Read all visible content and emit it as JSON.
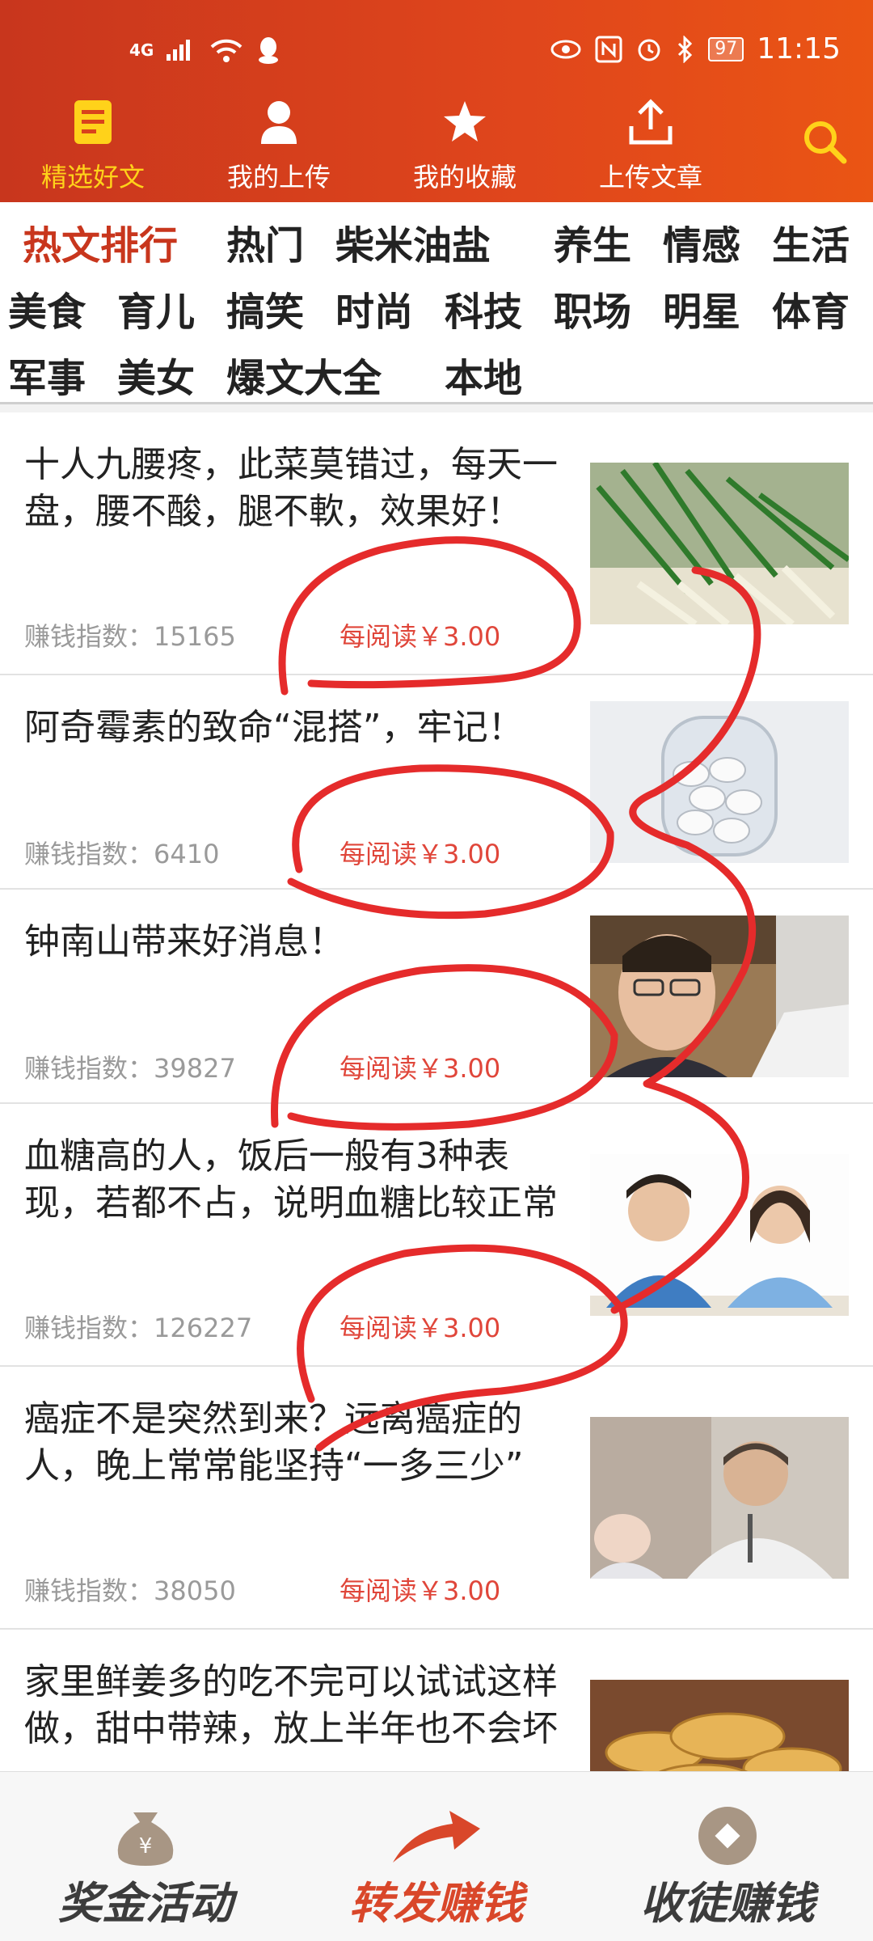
{
  "status": {
    "network": "4G",
    "battery": "97",
    "time": "11:15"
  },
  "topnav": [
    {
      "label": "精选好文",
      "icon": "document-icon"
    },
    {
      "label": "我的上传",
      "icon": "user-icon"
    },
    {
      "label": "我的收藏",
      "icon": "star-icon"
    },
    {
      "label": "上传文章",
      "icon": "upload-icon"
    }
  ],
  "categories": [
    "热文排行",
    "热门",
    "柴米油盐",
    "养生",
    "情感",
    "生活",
    "美食",
    "育儿",
    "搞笑",
    "时尚",
    "科技",
    "职场",
    "明星",
    "体育",
    "军事",
    "美女",
    "爆文大全",
    "本地"
  ],
  "articles": [
    {
      "title": "十人九腰疼，此菜莫错过，每天一盘，腰不酸，腿不軟，效果好！",
      "index_label": "赚钱指数：",
      "index": "15165",
      "reward": "每阅读￥3.00"
    },
    {
      "title": "阿奇霉素的致命“混搭”，牢记！",
      "index_label": "赚钱指数：",
      "index": "6410",
      "reward": "每阅读￥3.00"
    },
    {
      "title": "钟南山带来好消息！",
      "index_label": "赚钱指数：",
      "index": "39827",
      "reward": "每阅读￥3.00"
    },
    {
      "title": "血糖高的人，饭后一般有3种表现，若都不占，说明血糖比较正常",
      "index_label": "赚钱指数：",
      "index": "126227",
      "reward": "每阅读￥3.00"
    },
    {
      "title": "癌症不是突然到来？远离癌症的人，晚上常常能坚持“一多三少”",
      "index_label": "赚钱指数：",
      "index": "38050",
      "reward": "每阅读￥3.00"
    },
    {
      "title": "家里鲜姜多的吃不完可以试试这样做，甜中带辣，放上半年也不会坏",
      "index_label": "",
      "index": "",
      "reward": ""
    }
  ],
  "bottom": [
    {
      "label": "奖金活动",
      "icon": "money-bag-icon"
    },
    {
      "label": "转发赚钱",
      "icon": "share-arrow-icon"
    },
    {
      "label": "收徒赚钱",
      "icon": "coin-icon"
    }
  ],
  "colors": {
    "header": "#d9421c",
    "active": "#ffd21a",
    "reward": "#e0463a",
    "annotation": "#e52b2b"
  }
}
